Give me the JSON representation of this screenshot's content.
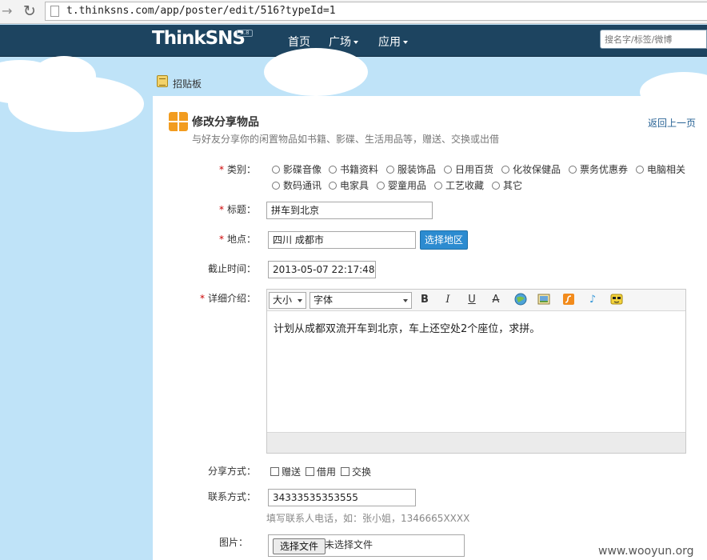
{
  "browser": {
    "url": "t.thinksns.com/app/poster/edit/516?typeId=1"
  },
  "header": {
    "logo": "ThinkSNS",
    "logo_version": "2.8",
    "nav": [
      {
        "label": "首页",
        "has_dropdown": false
      },
      {
        "label": "广场",
        "has_dropdown": true
      },
      {
        "label": "应用",
        "has_dropdown": true
      }
    ],
    "search_placeholder": "搜名字/标签/微博"
  },
  "breadcrumb": {
    "label": "招贴板"
  },
  "page": {
    "title": "修改分享物品",
    "subtitle": "与好友分享你的闲置物品如书籍、影碟、生活用品等，赠送、交换或出借",
    "back_link": "返回上一页"
  },
  "form": {
    "category": {
      "label": "类别：",
      "options": [
        "影碟音像",
        "书籍资料",
        "服装饰品",
        "日用百货",
        "化妆保健品",
        "票务优惠券",
        "电脑相关",
        "数码通讯",
        "电家具",
        "婴童用品",
        "工艺收藏",
        "其它"
      ]
    },
    "title": {
      "label": "标题：",
      "value": "拼车到北京"
    },
    "location": {
      "label": "地点：",
      "value": "四川 成都市",
      "button": "选择地区"
    },
    "deadline": {
      "label": "截止时间：",
      "value": "2013-05-07 22:17:48"
    },
    "description": {
      "label": "详细介绍：",
      "toolbar": {
        "size_label": "大小",
        "font_label": "字体"
      },
      "content": "计划从成都双流开车到北京，车上还空处2个座位，求拼。"
    },
    "share_method": {
      "label": "分享方式：",
      "options": [
        "赠送",
        "借用",
        "交换"
      ]
    },
    "contact": {
      "label": "联系方式：",
      "value": "34333535353555",
      "hint": "填写联系人电话，如：张小姐，1346665XXXX"
    },
    "image": {
      "label": "图片：",
      "button": "选择文件",
      "status": "未选择文件"
    }
  },
  "watermark": "www.wooyun.org",
  "colors": {
    "header_bg": "#1d4460",
    "sky": "#bfe3f8",
    "accent_blue": "#2c8bd0",
    "required": "#cc0000",
    "link": "#2a6496"
  }
}
